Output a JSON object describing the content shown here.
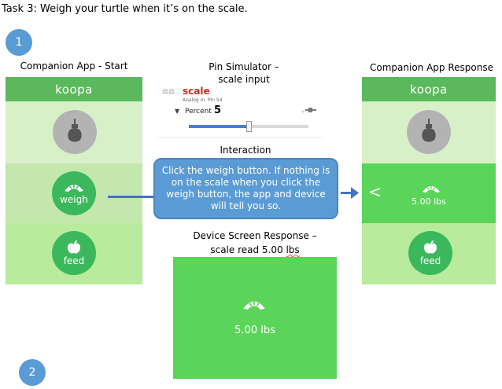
{
  "task_title": "Task 3: Weigh your turtle when it’s on the scale.",
  "step_badges": [
    "1",
    "2"
  ],
  "companion_start": {
    "caption": "Companion App - Start",
    "header": "koopa",
    "weigh_label": "weigh",
    "feed_label": "feed"
  },
  "pin_simulator": {
    "caption_line1": "Pin Simulator –",
    "caption_line2": "scale input",
    "title": "scale",
    "subtitle": "Analog In. Pin 54",
    "dropdown_label": "Percent",
    "value": "5",
    "slider_level_percent": 50
  },
  "interaction": {
    "title": "Interaction",
    "text": "Click the weigh button. If nothing is on the scale when you click the weigh button, the app and device will tell you so."
  },
  "device_screen": {
    "caption_line1": "Device Screen Response –",
    "caption_line2_prefix": "scale read 5.00 ",
    "caption_line2_unit": "lbs",
    "reading": "5.00 lbs"
  },
  "companion_response": {
    "caption": "Companion App Response",
    "header": "koopa",
    "reading": "5.00 lbs",
    "feed_label": "feed",
    "back_glyph": "<"
  },
  "colors": {
    "header_green": "#5cb85c",
    "panel_light_green": "#d8f0c8",
    "panel_mid_green": "#c3e7ad",
    "button_green": "#3cb85c",
    "active_green": "#5bd45a",
    "callout_blue": "#5b9bd5",
    "arrow_blue": "#4472c4"
  }
}
